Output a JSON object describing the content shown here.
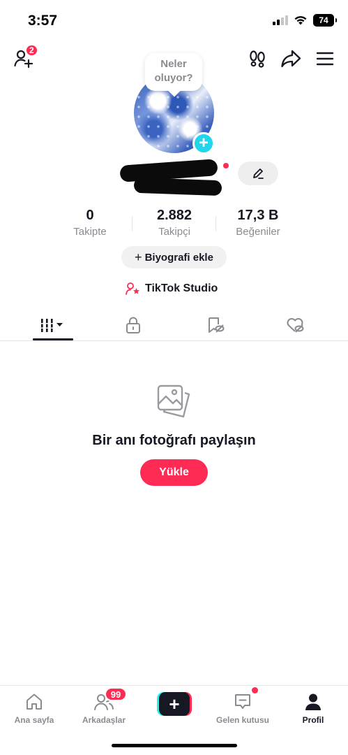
{
  "status_bar": {
    "time": "3:57",
    "battery": "74"
  },
  "top_nav": {
    "friend_requests_badge": "2"
  },
  "profile": {
    "bubble_text_line1": "Neler",
    "bubble_text_line2": "oluyor?",
    "add_avatar_icon": "+"
  },
  "stats": [
    {
      "value": "0",
      "label": "Takipte"
    },
    {
      "value": "2.882",
      "label": "Takipçi"
    },
    {
      "value": "17,3 B",
      "label": "Beğeniler"
    }
  ],
  "bio_button": {
    "icon": "+",
    "label": "Biyografi ekle"
  },
  "studio": {
    "label": "TikTok Studio"
  },
  "tabs": [
    {
      "icon": "grid-icon",
      "active": true
    },
    {
      "icon": "lock-icon",
      "active": false
    },
    {
      "icon": "bookmark-icon",
      "active": false
    },
    {
      "icon": "heart-hidden-icon",
      "active": false
    }
  ],
  "empty_state": {
    "title": "Bir anı fotoğrafı paylaşın",
    "button": "Yükle"
  },
  "bottom_nav": {
    "home": "Ana sayfa",
    "friends": "Arkadaşlar",
    "friends_badge": "99",
    "create_icon": "+",
    "inbox": "Gelen kutusu",
    "profile": "Profil"
  },
  "colors": {
    "accent": "#fe2c55",
    "cyan": "#20d5ec",
    "text": "#161823",
    "muted": "#8a8b91"
  }
}
